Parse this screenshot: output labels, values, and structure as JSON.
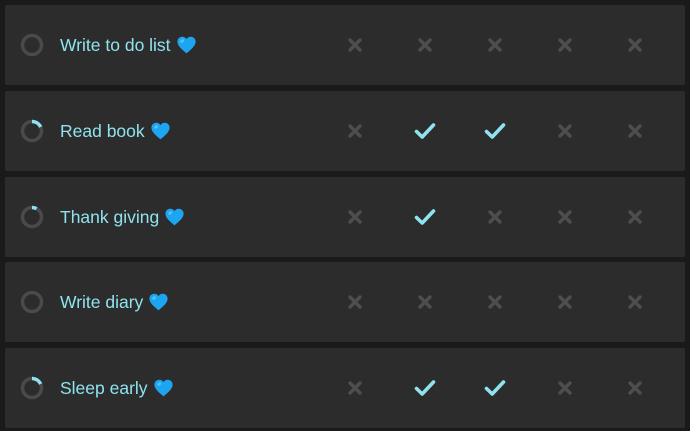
{
  "colors": {
    "background": "#1a1a1a",
    "row": "#2c2c2c",
    "accent": "#8fe3ef",
    "ring_track": "#4a4a4a",
    "ring_progress": "#8fe3ef",
    "cross": "#4e4e4e",
    "heart": "#1ea5f2"
  },
  "habits": [
    {
      "name": "Write to do list",
      "emoji": "blue-heart-icon",
      "progress": 0.0,
      "days": [
        false,
        false,
        false,
        false,
        false
      ]
    },
    {
      "name": "Read book",
      "emoji": "blue-heart-icon",
      "progress": 0.18,
      "days": [
        false,
        true,
        true,
        false,
        false
      ]
    },
    {
      "name": "Thank giving",
      "emoji": "blue-heart-icon",
      "progress": 0.08,
      "days": [
        false,
        true,
        false,
        false,
        false
      ]
    },
    {
      "name": "Write diary",
      "emoji": "blue-heart-icon",
      "progress": 0.0,
      "days": [
        false,
        false,
        false,
        false,
        false
      ]
    },
    {
      "name": "Sleep early",
      "emoji": "blue-heart-icon",
      "progress": 0.18,
      "days": [
        false,
        true,
        true,
        false,
        false
      ]
    }
  ]
}
